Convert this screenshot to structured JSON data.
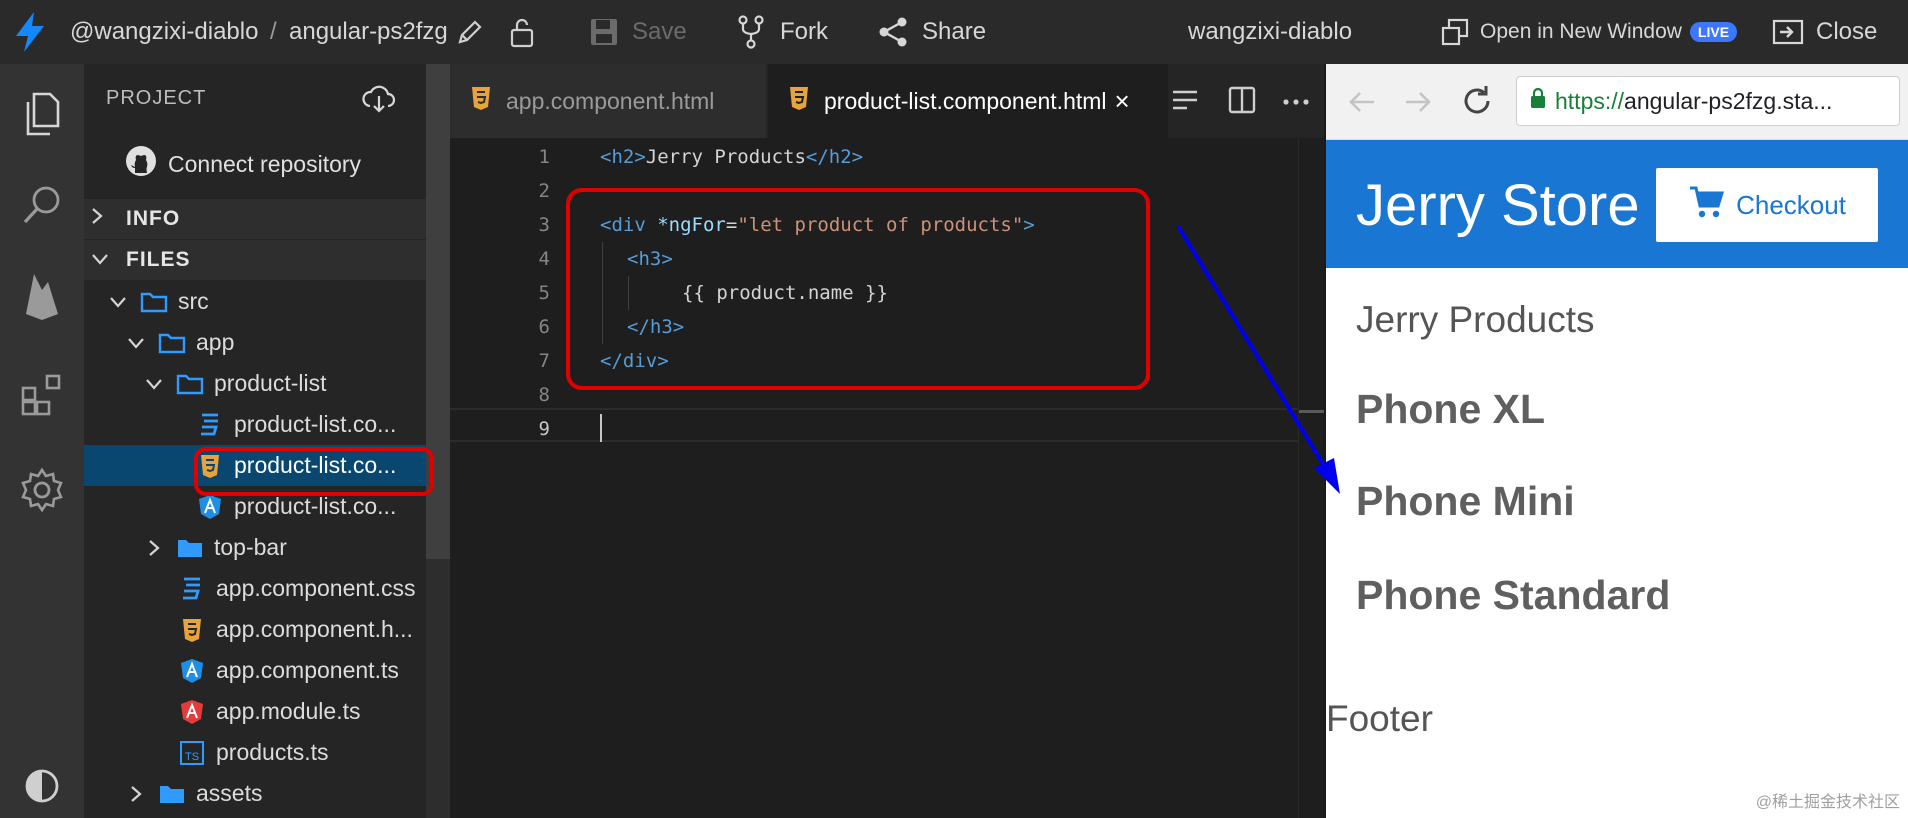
{
  "topbar": {
    "owner": "@wangzixi-diablo",
    "separator": "/",
    "project": "angular-ps2fzg",
    "save_label": "Save",
    "fork_label": "Fork",
    "share_label": "Share",
    "user": "wangzixi-diablo",
    "open_new_window_label": "Open in New Window",
    "live_badge": "LIVE",
    "close_label": "Close"
  },
  "sidebar": {
    "project_title": "PROJECT",
    "connect_repository": "Connect repository",
    "info_label": "INFO",
    "files_label": "FILES",
    "tree": [
      {
        "label": "src",
        "type": "folder"
      },
      {
        "label": "app",
        "type": "folder"
      },
      {
        "label": "product-list",
        "type": "folder"
      },
      {
        "label": "product-list.co...",
        "type": "css"
      },
      {
        "label": "product-list.co...",
        "type": "html",
        "selected": true
      },
      {
        "label": "product-list.co...",
        "type": "ts-angular"
      },
      {
        "label": "top-bar",
        "type": "folder"
      },
      {
        "label": "app.component.css",
        "type": "css"
      },
      {
        "label": "app.component.h...",
        "type": "html"
      },
      {
        "label": "app.component.ts",
        "type": "ts-angular"
      },
      {
        "label": "app.module.ts",
        "type": "module"
      },
      {
        "label": "products.ts",
        "type": "ts"
      },
      {
        "label": "assets",
        "type": "folder"
      }
    ]
  },
  "editor": {
    "tabs": [
      {
        "label": "app.component.html",
        "active": false
      },
      {
        "label": "product-list.component.html",
        "active": true,
        "close": "×"
      }
    ],
    "line_numbers": [
      "1",
      "2",
      "3",
      "4",
      "5",
      "6",
      "7",
      "8",
      "9"
    ],
    "code": {
      "l1_open": "<h2>",
      "l1_text": "Jerry Products",
      "l1_close": "</h2>",
      "l3_open": "<div",
      "l3_attr": "*ngFor",
      "l3_eq": "=",
      "l3_str": "\"let product of products\"",
      "l3_end": ">",
      "l4": "<h3>",
      "l5": "{{ product.name }}",
      "l6": "</h3>",
      "l7": "</div>"
    }
  },
  "preview": {
    "url_scheme": "https://",
    "url_rest": "angular-ps2fzg.sta...",
    "app_title": "Jerry Store",
    "checkout_label": "Checkout",
    "heading": "Jerry Products",
    "products": [
      "Phone XL",
      "Phone Mini",
      "Phone Standard"
    ],
    "footer": "Footer",
    "watermark": "@稀土掘金技术社区"
  },
  "colors": {
    "accent": "#1976d2",
    "highlight_red": "#e00000",
    "arrow_blue": "#0000ee",
    "selected_row": "#094771"
  }
}
